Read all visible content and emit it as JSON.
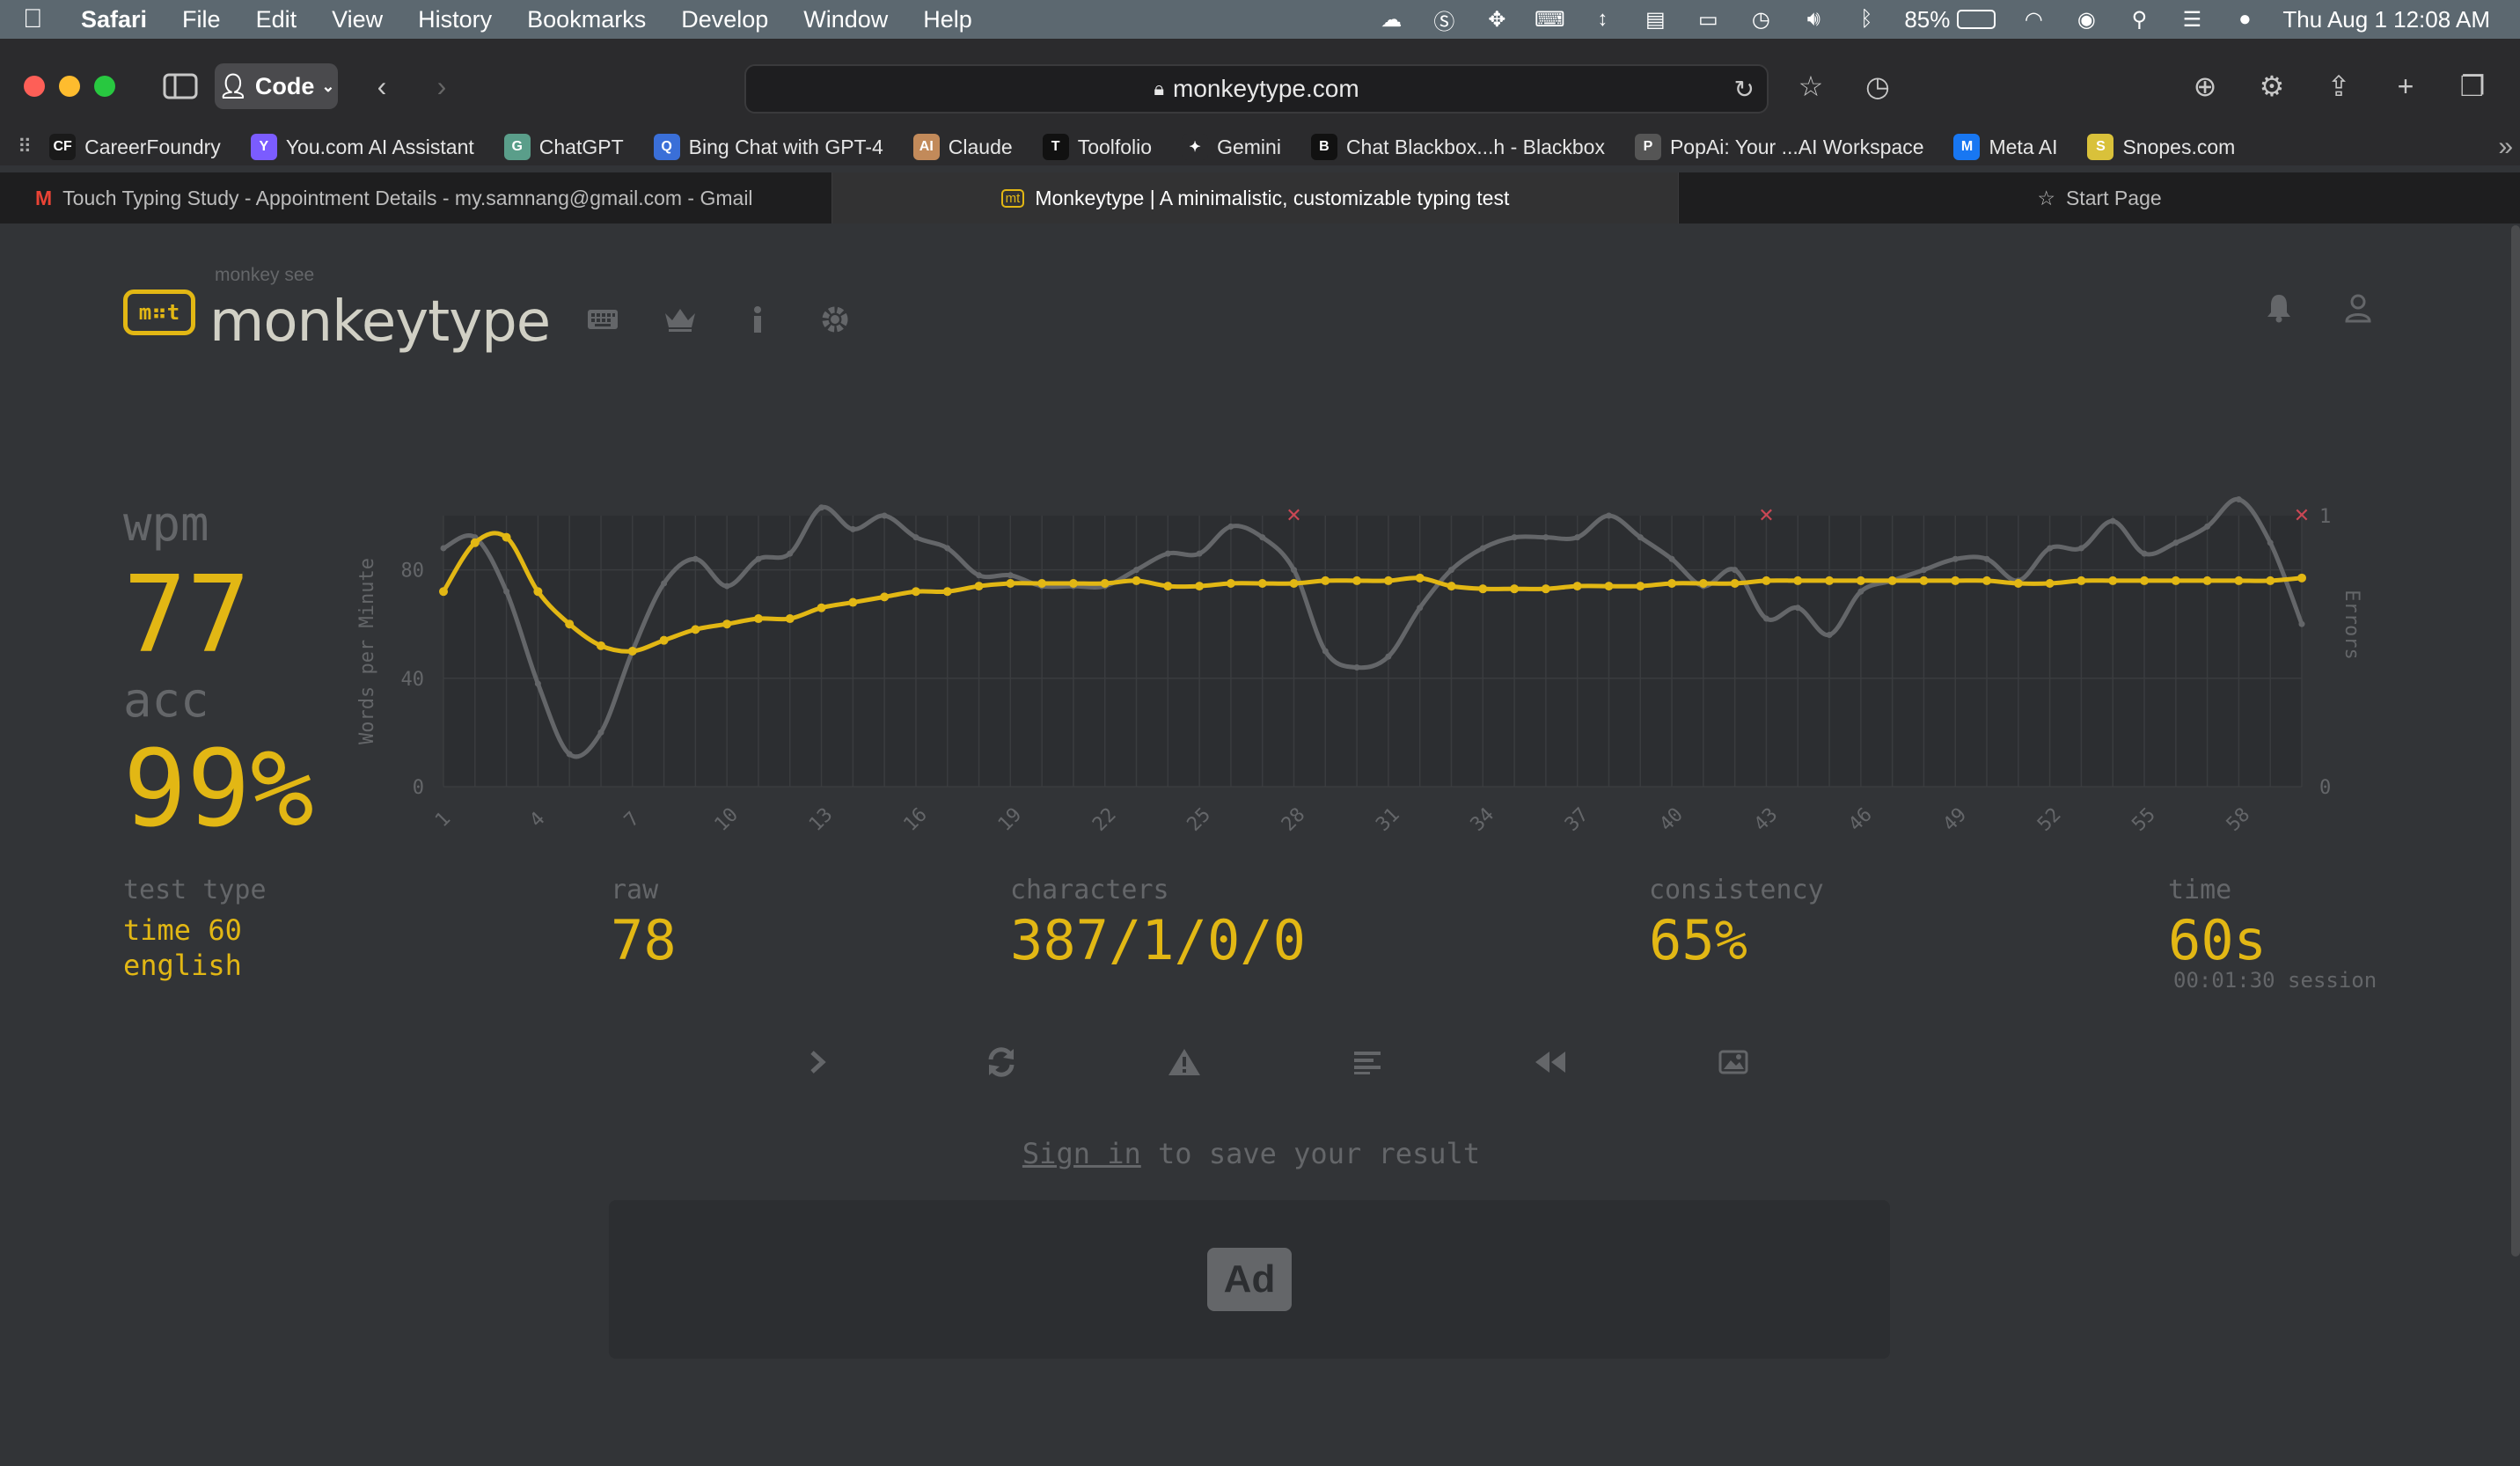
{
  "menubar": {
    "app": "Safari",
    "items": [
      "File",
      "Edit",
      "View",
      "History",
      "Bookmarks",
      "Develop",
      "Window",
      "Help"
    ],
    "battery": "85%",
    "battery_level": 0.85,
    "datetime": "Thu Aug 1  12:08 AM"
  },
  "toolbar": {
    "profile_label": "Code",
    "url": "monkeytype.com"
  },
  "bookmarks": [
    {
      "label": "CareerFoundry",
      "fav": "CF",
      "color": "#1a1a1a"
    },
    {
      "label": "You.com AI Assistant",
      "fav": "Y",
      "color": "#7b5cff"
    },
    {
      "label": "ChatGPT",
      "fav": "G",
      "color": "#5a9e8a"
    },
    {
      "label": "Bing Chat with GPT-4",
      "fav": "Q",
      "color": "#3a6fd8"
    },
    {
      "label": "Claude",
      "fav": "AI",
      "color": "#c28a5a"
    },
    {
      "label": "Toolfolio",
      "fav": "T",
      "color": "#111111"
    },
    {
      "label": "Gemini",
      "fav": "✦",
      "color": "#2b2b2d"
    },
    {
      "label": "Chat Blackbox...h - Blackbox",
      "fav": "B",
      "color": "#111111"
    },
    {
      "label": "PopAi: Your ...AI Workspace",
      "fav": "P",
      "color": "#555555"
    },
    {
      "label": "Meta AI",
      "fav": "M",
      "color": "#1877f2"
    },
    {
      "label": "Snopes.com",
      "fav": "S",
      "color": "#d9c13a"
    }
  ],
  "tabs": [
    {
      "label": "Touch Typing Study - Appointment Details - my.samnang@gmail.com - Gmail",
      "fav": "M"
    },
    {
      "label": "Monkeytype | A minimalistic, customizable typing test",
      "fav": "mt"
    },
    {
      "label": "Start Page",
      "fav": "☆"
    }
  ],
  "brand": {
    "logo": "m⠶t",
    "sub": "monkey see",
    "name": "monkeytype"
  },
  "result": {
    "wpm_label": "wpm",
    "wpm": "77",
    "acc_label": "acc",
    "acc": "99%",
    "test_type_label": "test type",
    "test_type_line1": "time 60",
    "test_type_line2": "english",
    "raw_label": "raw",
    "raw": "78",
    "characters_label": "characters",
    "characters": "387/1/0/0",
    "consistency_label": "consistency",
    "consistency": "65%",
    "time_label": "time",
    "time": "60s",
    "session": "00:01:30 session"
  },
  "signin": {
    "link": "Sign in",
    "rest": " to save your result"
  },
  "ad_label": "Ad",
  "colors": {
    "accent": "#e2b714",
    "sub": "#646669",
    "bg": "#323437",
    "error": "#ca4754"
  },
  "chart_data": {
    "type": "line",
    "ylabel": "Words per Minute",
    "y2label": "Errors",
    "ylim": [
      0,
      100
    ],
    "y2lim": [
      0,
      1
    ],
    "yticks": [
      0,
      40,
      80
    ],
    "y2ticks": [
      0,
      1
    ],
    "x": [
      1,
      2,
      3,
      4,
      5,
      6,
      7,
      8,
      9,
      10,
      11,
      12,
      13,
      14,
      15,
      16,
      17,
      18,
      19,
      20,
      21,
      22,
      23,
      24,
      25,
      26,
      27,
      28,
      29,
      30,
      31,
      32,
      33,
      34,
      35,
      36,
      37,
      38,
      39,
      40,
      41,
      42,
      43,
      44,
      45,
      46,
      47,
      48,
      49,
      50,
      51,
      52,
      53,
      54,
      55,
      56,
      57,
      58,
      59,
      60
    ],
    "xticks": [
      1,
      4,
      7,
      10,
      13,
      16,
      19,
      22,
      25,
      28,
      31,
      34,
      37,
      40,
      43,
      46,
      49,
      52,
      55,
      58
    ],
    "grid": true,
    "series": [
      {
        "name": "wpm",
        "color": "#e2b714",
        "values": [
          72,
          90,
          92,
          72,
          60,
          52,
          50,
          54,
          58,
          60,
          62,
          62,
          66,
          68,
          70,
          72,
          72,
          74,
          75,
          75,
          75,
          75,
          76,
          74,
          74,
          75,
          75,
          75,
          76,
          76,
          76,
          77,
          74,
          73,
          73,
          73,
          74,
          74,
          74,
          75,
          75,
          75,
          76,
          76,
          76,
          76,
          76,
          76,
          76,
          76,
          75,
          75,
          76,
          76,
          76,
          76,
          76,
          76,
          76,
          77
        ]
      },
      {
        "name": "raw",
        "color": "#646669",
        "values": [
          88,
          92,
          72,
          38,
          12,
          20,
          50,
          75,
          84,
          74,
          84,
          86,
          103,
          95,
          100,
          92,
          88,
          78,
          78,
          74,
          74,
          74,
          80,
          86,
          86,
          96,
          92,
          80,
          50,
          44,
          48,
          66,
          80,
          88,
          92,
          92,
          92,
          100,
          92,
          84,
          74,
          80,
          62,
          66,
          56,
          72,
          76,
          80,
          84,
          84,
          76,
          88,
          88,
          98,
          86,
          90,
          96,
          106,
          90,
          60
        ]
      },
      {
        "name": "errors",
        "color": "#ca4754",
        "points": [
          [
            28,
            1
          ],
          [
            43,
            1
          ],
          [
            60,
            1
          ]
        ]
      }
    ]
  }
}
